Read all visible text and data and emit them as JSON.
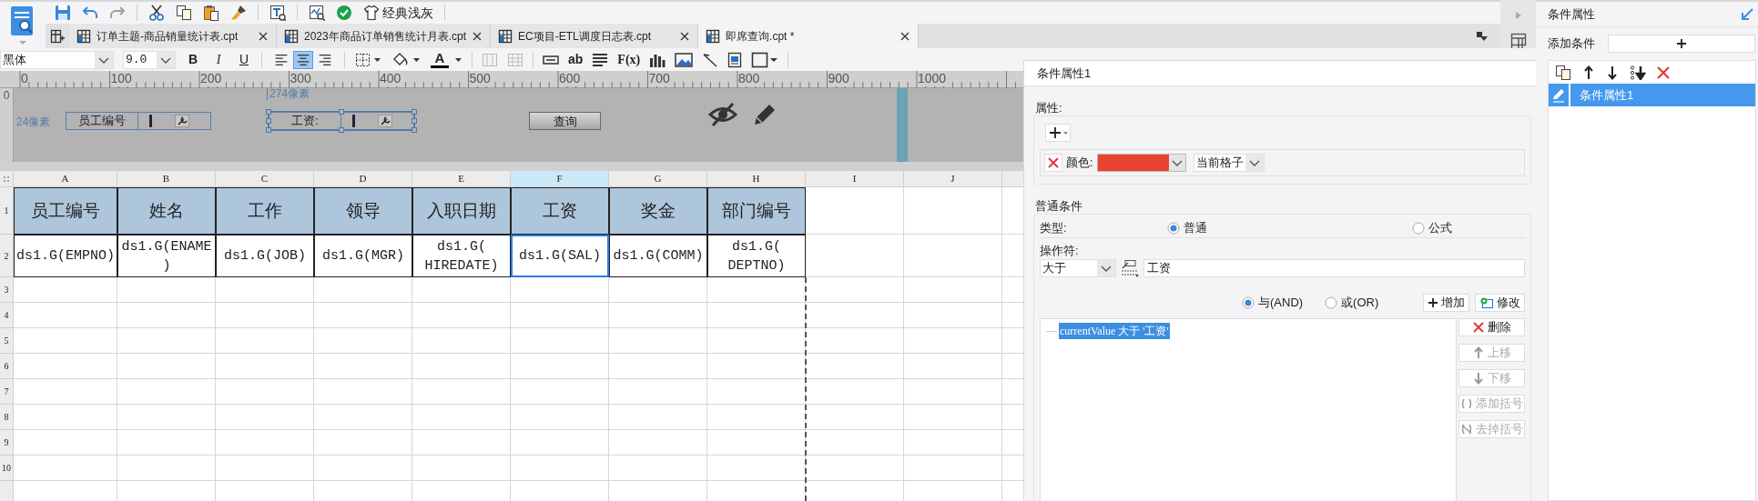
{
  "toolbar": {
    "theme_button": "经典浅灰"
  },
  "tabs": [
    {
      "label": "订单主题-商品销量统计表.cpt",
      "selected": false
    },
    {
      "label": "2023年商品订单销售统计月表.cpt",
      "selected": false
    },
    {
      "label": "EC项目-ETL调度日志表.cpt",
      "selected": false
    },
    {
      "label": "即席查询.cpt *",
      "selected": true
    }
  ],
  "format_bar": {
    "font": "黑体",
    "font_size": "9.0",
    "style_buttons": [
      "B",
      "I",
      "U"
    ],
    "align_buttons": [
      {
        "selected": false
      },
      {
        "selected": true
      },
      {
        "selected": false
      }
    ],
    "font_color_button": "A",
    "cell_buttons": [
      "ab",
      "F(x)"
    ]
  },
  "ruler": {
    "ticks": [
      "0",
      "100",
      "200",
      "300",
      "400",
      "500",
      "600",
      "700",
      "800",
      "900",
      "1000"
    ],
    "side_tick": "0"
  },
  "form": {
    "height_hint": "24像素",
    "width_hint": "274像素",
    "widgets": [
      {
        "kind": "field",
        "label": "员工编号",
        "selected": false
      },
      {
        "kind": "field",
        "label": "工资:",
        "selected": true
      },
      {
        "kind": "button",
        "label": "查询"
      }
    ]
  },
  "sheet": {
    "columns": [
      {
        "label": "A",
        "selected": false
      },
      {
        "label": "B",
        "selected": false
      },
      {
        "label": "C",
        "selected": false
      },
      {
        "label": "D",
        "selected": false
      },
      {
        "label": "E",
        "selected": false
      },
      {
        "label": "F",
        "selected": true
      },
      {
        "label": "G",
        "selected": false
      },
      {
        "label": "H",
        "selected": false
      },
      {
        "label": "I",
        "selected": false
      },
      {
        "label": "J",
        "selected": false
      }
    ],
    "rows": [
      {
        "label": "1",
        "cells": [
          {
            "text": "员工编号",
            "kind": "header",
            "selected": false
          },
          {
            "text": "姓名",
            "kind": "header",
            "selected": false
          },
          {
            "text": "工作",
            "kind": "header",
            "selected": false
          },
          {
            "text": "领导",
            "kind": "header",
            "selected": false
          },
          {
            "text": "入职日期",
            "kind": "header",
            "selected": false
          },
          {
            "text": "工资",
            "kind": "header",
            "selected": false
          },
          {
            "text": "奖金",
            "kind": "header",
            "selected": false
          },
          {
            "text": "部门编号",
            "kind": "header",
            "selected": false
          }
        ]
      },
      {
        "label": "2",
        "cells": [
          {
            "text": "ds1.G(EMPNO)",
            "kind": "data",
            "selected": false
          },
          {
            "text": "ds1.G(ENAME\n)",
            "kind": "data",
            "selected": false
          },
          {
            "text": "ds1.G(JOB)",
            "kind": "data",
            "selected": false
          },
          {
            "text": "ds1.G(MGR)",
            "kind": "data",
            "selected": false
          },
          {
            "text": "ds1.G(\nHIREDATE)",
            "kind": "data",
            "selected": false
          },
          {
            "text": "ds1.G(SAL)",
            "kind": "data",
            "selected": true
          },
          {
            "text": "ds1.G(COMM)",
            "kind": "data",
            "selected": false
          },
          {
            "text": "ds1.G(\nDEPTNO)",
            "kind": "data",
            "selected": false
          }
        ]
      },
      {
        "label": "3"
      },
      {
        "label": "4"
      },
      {
        "label": "5"
      },
      {
        "label": "6"
      },
      {
        "label": "7"
      },
      {
        "label": "8"
      },
      {
        "label": "9"
      },
      {
        "label": "10"
      }
    ]
  },
  "condition_dialog": {
    "title": "条件属性1",
    "property_section": "属性:",
    "properties": [
      {
        "label": "颜色:",
        "color": "#e84332",
        "scope": "当前格子"
      }
    ],
    "condition_section": "普通条件",
    "type_label": "类型:",
    "type_options": [
      {
        "label": "普通",
        "selected": true
      },
      {
        "label": "公式",
        "selected": false
      }
    ],
    "operator_label": "操作符:",
    "operator": "大于",
    "value": "工资",
    "join_options": [
      {
        "label": "与(AND)",
        "selected": true
      },
      {
        "label": "或(OR)",
        "selected": false
      }
    ],
    "add_button": "增加",
    "modify_button": "修改",
    "conditions": [
      {
        "text": "currentValue 大于 '工资'",
        "selected": true
      }
    ],
    "side_buttons": [
      {
        "label": "删除",
        "disabled": false
      },
      {
        "label": "上移",
        "disabled": true
      },
      {
        "label": "下移",
        "disabled": true
      },
      {
        "label": "添加括号",
        "disabled": true
      },
      {
        "label": "去掉括号",
        "disabled": true
      }
    ]
  },
  "condition_panel": {
    "title": "条件属性",
    "add_label": "添加条件",
    "items": [
      {
        "label": "条件属性1",
        "selected": true
      }
    ]
  }
}
